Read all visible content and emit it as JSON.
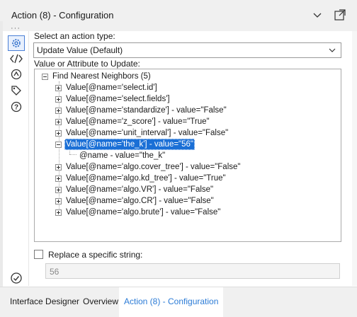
{
  "window": {
    "title": "Action (8) - Configuration"
  },
  "action": {
    "select_label": "Select an action type:",
    "selected": "Update Value (Default)",
    "tree_label": "Value or Attribute to Update:"
  },
  "tree": {
    "root": "Find Nearest Neighbors (5)",
    "items": [
      "Value[@name='select.id']",
      "Value[@name='select.fields']",
      "Value[@name='standardize'] - value=\"False\"",
      "Value[@name='z_score'] - value=\"True\"",
      "Value[@name='unit_interval'] - value=\"False\"",
      "Value[@name='the_k'] - value=\"56\"",
      "Value[@name='algo.cover_tree'] - value=\"False\"",
      "Value[@name='algo.kd_tree'] - value=\"True\"",
      "Value[@name='algo.VR'] - value=\"False\"",
      "Value[@name='algo.CR'] - value=\"False\"",
      "Value[@name='algo.brute'] - value=\"False\""
    ],
    "child": "@name - value=\"the_k\""
  },
  "replace": {
    "label": "Replace a specific string:",
    "value": "56"
  },
  "tabs": [
    "Interface Designer",
    "Overview",
    "Action (8) - Configuration"
  ],
  "colors": {
    "accent": "#2b7bd6",
    "selection": "#1a6fd6"
  },
  "icons": [
    "gear-icon",
    "code-icon",
    "workflow-icon",
    "tag-icon",
    "help-icon",
    "check-circle-icon",
    "chevron-down-icon",
    "popout-icon"
  ]
}
